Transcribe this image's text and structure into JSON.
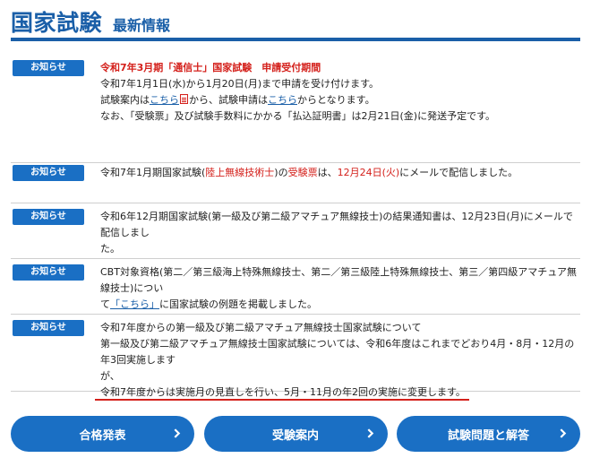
{
  "header": {
    "title": "国家試験",
    "subtitle": "最新情報"
  },
  "news": [
    {
      "badge": "お知らせ",
      "headline": "令和7年3月期「通信士」国家試験　申請受付期間",
      "line1": "令和7年1月1日(水)から1月20日(月)まで申請を受け付けます。",
      "line2_a": "試験案内は",
      "line2_link1": "こちら",
      "line2_b": "から、試験申請は",
      "line2_link2": "こちら",
      "line2_c": "からとなります。",
      "line3": "なお、「受験票」及び試験手数料にかかる「払込証明書」は2月21日(金)に発送予定です。"
    },
    {
      "badge": "お知らせ",
      "p1": "令和7年1月期国家試験(",
      "p2": "陸上無線技術士",
      "p3": ")の",
      "p4": "受験票",
      "p5": "は、",
      "p6": "12月24日(火)",
      "p7": "にメールで配信しました。"
    },
    {
      "badge": "お知らせ",
      "line1": "令和6年12月期国家試験(第一級及び第二級アマチュア無線技士)の結果通知書は、12月23日(月)にメールで配信しまし",
      "line2": "た。"
    },
    {
      "badge": "お知らせ",
      "line1": "CBT対象資格(第二／第三級海上特殊無線技士、第二／第三級陸上特殊無線技士、第三／第四級アマチュア無線技士)につい",
      "line2_a": "て",
      "line2_link": "「こちら」",
      "line2_b": "に国家試験の例題を掲載しました。"
    },
    {
      "badge": "お知らせ",
      "line1": "令和7年度からの第一級及び第二級アマチュア無線技士国家試験について",
      "line2": "第一級及び第二級アマチュア無線技士国家試験については、令和6年度はこれまでどおり4月・8月・12月の年3回実施します",
      "line3": "が、",
      "line4": "令和7年度からは実施月の見直しを行い、5月・11月の年2回の実施に変更します。"
    }
  ],
  "nav": {
    "results": "合格発表",
    "guide": "受験案内",
    "questions": "試験問題と解答"
  },
  "colors": {
    "brand": "#1a5fa8",
    "button": "#1a6fc4",
    "alert": "#d4201b"
  }
}
